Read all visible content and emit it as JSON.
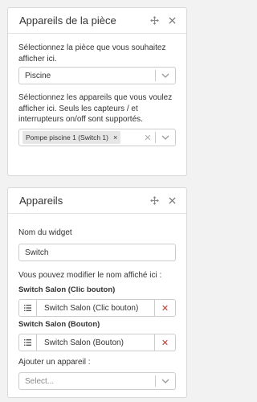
{
  "panel1": {
    "title": "Appareils de la pièce",
    "room_help": "Sélectionnez la pièce que vous souhaitez afficher ici.",
    "room_value": "Piscine",
    "devices_help": "Sélectionnez les appareils que vous voulez afficher ici. Seuls les capteurs / et interrupteurs on/off sont supportés.",
    "selected_tags": [
      "Pompe piscine 1 (Switch 1)"
    ]
  },
  "panel2": {
    "title": "Appareils",
    "widget_name_label": "Nom du widget",
    "widget_name_value": "Switch",
    "modify_help": "Vous pouvez modifier le nom affiché ici :",
    "items": [
      {
        "label": "Switch Salon (Clic bouton)",
        "value": "Switch Salon (Clic bouton)"
      },
      {
        "label": "Switch Salon (Bouton)",
        "value": "Switch Salon (Bouton)"
      }
    ],
    "add_label": "Ajouter un appareil :",
    "add_placeholder": "Select..."
  },
  "icons": {
    "move": "move-arrows-icon",
    "close": "close-icon",
    "chevron": "chevron-down-icon",
    "handle": "list-handle-icon",
    "delete": "delete-x-icon"
  },
  "colors": {
    "delete": "#c0392b",
    "border": "#cccccc",
    "background": "#f2f2f2"
  }
}
